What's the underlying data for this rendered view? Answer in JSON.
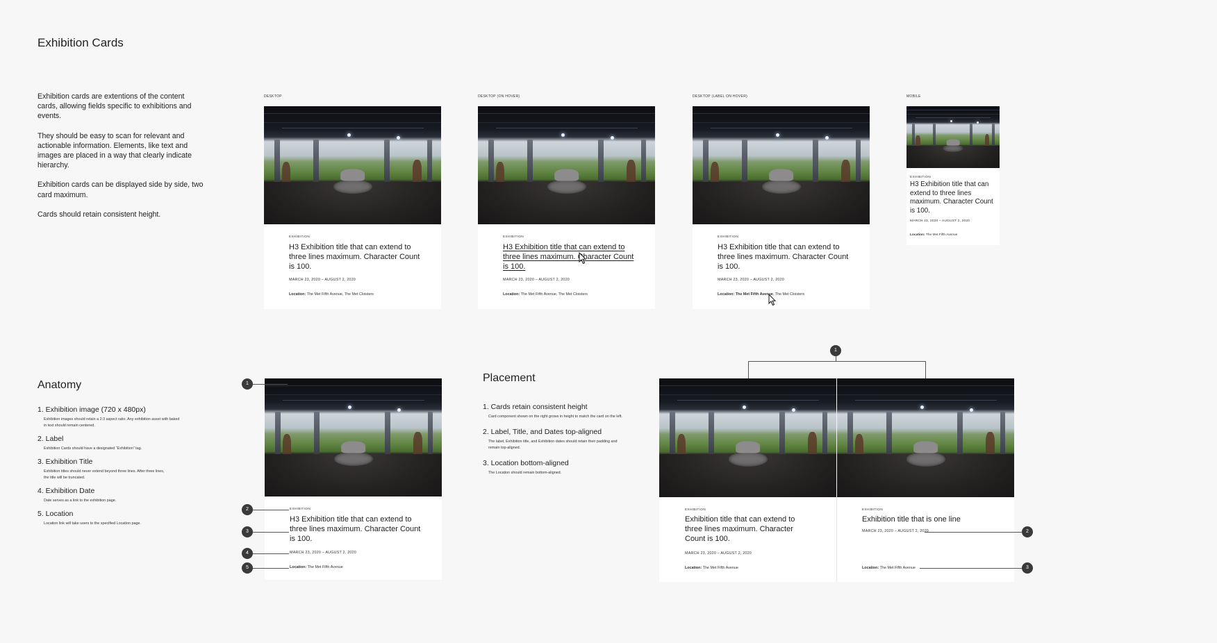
{
  "page_title": "Exhibition Cards",
  "intro": [
    "Exhibition cards are extentions of the content cards, allowing fields specific to exhibitions and events.",
    "They should be easy to scan for relevant and actionable information. Elements, like text and images are placed in a way that clearly indicate hierarchy.",
    "Exhibition cards can be displayed side by side, two card maximum.",
    "Cards should retain consistent height."
  ],
  "variants": [
    {
      "label": "DESKTOP"
    },
    {
      "label": "DESKTOP (ON HOVER)"
    },
    {
      "label": "DESKTOP (LABEL ON HOVER)"
    },
    {
      "label": "MOBILE"
    }
  ],
  "card": {
    "tag": "EXHIBITION",
    "title": "H3 Exhibition title that can extend to three lines maximum. Character Count is 100.",
    "dates": "MARCH 23, 2020 – AUGUST 2, 2020",
    "location_label": "Location:",
    "location_full": "The Met Fifth Avenue, The Met Cloisters",
    "location_a": "The Met Fifth Avenue",
    "location_b": ", The Met Cloisters",
    "location_short": "The Met Fifth Avenue"
  },
  "anatomy": {
    "title": "Anatomy",
    "items": [
      {
        "h": "1. Exhibition image (720 x 480px)",
        "d": "Exhibition images should retain a 2:3 aspect ratio. Any exhibition asset with baked in text should remain centered."
      },
      {
        "h": "2. Label",
        "d": "Exhibition Cards should have a designated “Exhibition” tag."
      },
      {
        "h": "3. Exhibition Title",
        "d": "Exhibition titles should never extend beyond three lines. After three lines, the title will be truncated."
      },
      {
        "h": "4. Exhibition Date",
        "d": "Date serves as a link to the exhibition page."
      },
      {
        "h": "5. Location",
        "d": "Location link will take users to the specified Location page."
      }
    ],
    "markers": [
      "1",
      "2",
      "3",
      "4",
      "5"
    ]
  },
  "placement": {
    "title": "Placement",
    "items": [
      {
        "h": "1. Cards retain consistent height",
        "d": "Card component shown on the right grows in height to match the card on the left."
      },
      {
        "h": "2. Label, Title, and Dates top-aligned",
        "d": "The label, Exhibition title, and Exhibition dates should retain their padding and remain top-aligned."
      },
      {
        "h": "3. Location bottom-aligned",
        "d": "The Location should remain bottom-aligned."
      }
    ],
    "markers": [
      "1",
      "2",
      "3"
    ],
    "left_card_title": "Exhibition title that can extend to three lines maximum. Character Count is 100.",
    "right_card_title": "Exhibition title that is one line",
    "dates": "MARCH 23, 2020 – AUGUST 2, 2020",
    "location_label": "Location:",
    "location": "The Met Fifth Avenue"
  }
}
